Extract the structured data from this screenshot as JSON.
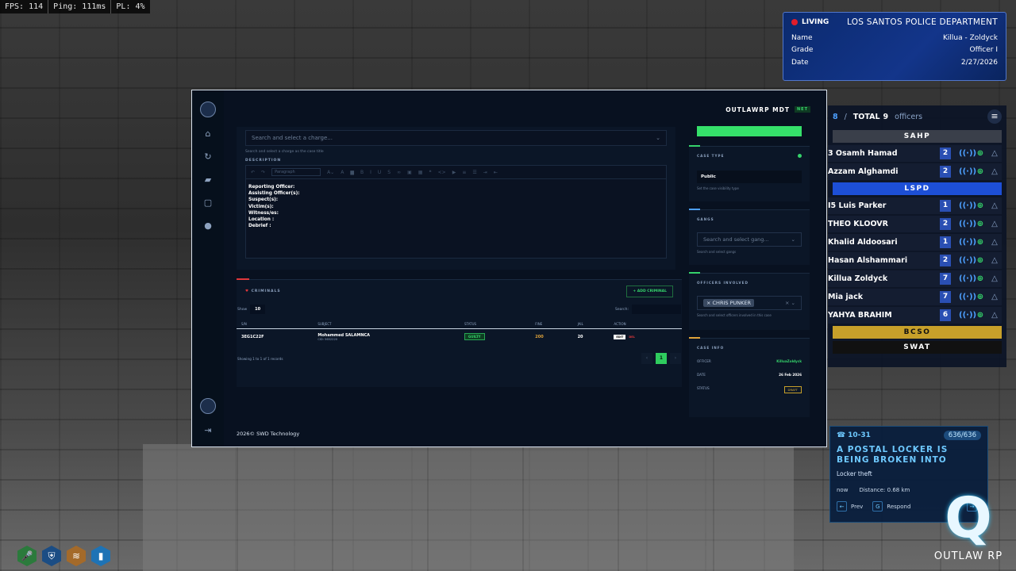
{
  "perf": {
    "fps": "FPS: 114",
    "ping": "Ping: 111ms",
    "pl": "PL: 4%"
  },
  "idcard": {
    "status": "LIVING",
    "department": "LOS SANTOS POLICE DEPARTMENT",
    "name_label": "Name",
    "name": "Killua - Zoldyck",
    "grade_label": "Grade",
    "grade": "Officer I",
    "date_label": "Date",
    "date": "2/27/2026"
  },
  "roster": {
    "online": "8",
    "sep": "/",
    "total_label": "TOTAL",
    "total": "9",
    "officers_label": "officers",
    "groups": {
      "sahp": "SAHP",
      "lspd": "LSPD",
      "bcso": "BCSO",
      "swat": "SWAT"
    },
    "sahp_members": [
      {
        "name": "3 Osamh Hamad",
        "num": "2"
      },
      {
        "name": "Azzam Alghamdi",
        "num": "2"
      }
    ],
    "lspd_members": [
      {
        "name": "I5 Luis Parker",
        "num": "1"
      },
      {
        "name": "THEO KLOOVR",
        "num": "2"
      },
      {
        "name": "Khalid Aldoosari",
        "num": "1"
      },
      {
        "name": "Hasan Alshammari",
        "num": "2"
      },
      {
        "name": "Killua Zoldyck",
        "num": "7"
      },
      {
        "name": "Mia jack",
        "num": "7"
      },
      {
        "name": "YAHYA BRAHIM",
        "num": "6"
      }
    ]
  },
  "dispatch": {
    "code": "10-31",
    "count": "636/636",
    "title": "A POSTAL LOCKER IS BEING BROKEN INTO",
    "subtitle": "Locker theft",
    "time": "now",
    "distance": "Distance: 0.68 km",
    "prev": "Prev",
    "respond": "Respond"
  },
  "logo": {
    "mark": "Q",
    "text": "OUTLAW RP"
  },
  "mdt": {
    "app_title": "OUTLAWRP MDT",
    "version_badge": "NET",
    "charge_placeholder": "Search and select a charge...",
    "charge_hint": "Search and select a charge as the case title",
    "description_label": "DESCRIPTION",
    "paragraph": "Paragraph",
    "description_lines": [
      "Reporting Officer:",
      "Assisting Officer(s):",
      "Suspect(s):",
      "Victim(s):",
      "Witness/es:",
      "Location :",
      "Debrief :"
    ],
    "criminals_label": "CRIMINALS",
    "add_criminal": "+ ADD CRIMINAL",
    "show_label": "Show",
    "show_value": "10",
    "search_label": "Search:",
    "columns": [
      "S/N",
      "SUBJECT",
      "STATUS",
      "FINE",
      "JAIL",
      "ACTION"
    ],
    "rows": [
      {
        "sn": "3EG1C22F",
        "subject": "Mohammed SALAMNCA",
        "cid": "CID: 5652220",
        "status": "GUILTY",
        "fine": "200",
        "jail": "20",
        "edit": "EDIT",
        "del": "DEL"
      }
    ],
    "showing": "Showing 1 to 1 of 1 records",
    "page": "1",
    "copyright_year": "2026©",
    "copyright": "SWD Technology",
    "case_type_label": "CASE TYPE",
    "case_type_value": "Public",
    "case_type_hint": "Set the case visibility type",
    "gangs_label": "GANGS",
    "gangs_placeholder": "Search and select gang...",
    "gangs_hint": "Search and select gangs",
    "officers_label": "OFFICERS INVOLVED",
    "officer_chip": "× CHRIS PUNKER",
    "officers_hint": "Search and select officers involved in this case",
    "case_info_label": "CASE INFO",
    "officer_key": "OFFICER",
    "officer_val": "KilluaZoldyck",
    "date_key": "DATE",
    "date_val": "26 Feb 2026",
    "status_key": "STATUS",
    "status_val": "DRAFT"
  },
  "colors": {
    "accent": "#35d36b",
    "danger": "#e0373b",
    "lspd": "#1d4fd6",
    "bcso": "#c7a02a",
    "sahp": "#3a3f4a"
  }
}
